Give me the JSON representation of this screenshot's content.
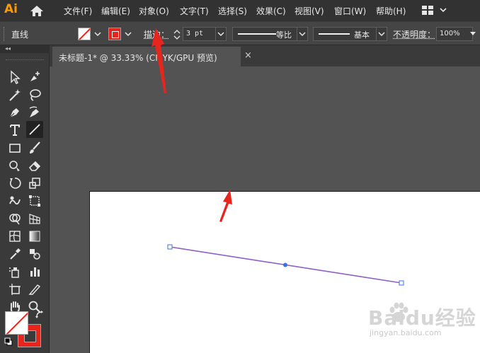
{
  "app": {
    "logo": "Ai",
    "menu": [
      "文件(F)",
      "编辑(E)",
      "对象(O)",
      "文字(T)",
      "选择(S)",
      "效果(C)",
      "视图(V)",
      "窗口(W)",
      "帮助(H)"
    ]
  },
  "icons": [
    "home-icon",
    "workspace-switcher-icon",
    "chevron-down-icon",
    "toolbox-collapse-icon",
    "close-icon",
    "swap-fill-stroke-icon",
    "default-fill-stroke-icon"
  ],
  "control_bar": {
    "tool_name": "直线",
    "stroke_label": "描边：",
    "stroke_weight": "3 pt",
    "variable_width_profile": "等比",
    "brush_definition": "基本",
    "opacity_label": "不透明度：",
    "opacity_value": "100%"
  },
  "colors": {
    "stroke": "#e8251c",
    "fill": "none",
    "path_color": "#8e5fc7",
    "anchor_color": "#3f6fe0",
    "annotation_arrow": "#e8251c"
  },
  "document_tab": {
    "title": "未标题-1* @ 33.33% (CMYK/GPU 预览)",
    "close": "×"
  },
  "toolbox": {
    "collapse": "◂◂",
    "tools": [
      [
        "selection-tool",
        "direct-selection-tool"
      ],
      [
        "magic-wand-tool",
        "lasso-tool"
      ],
      [
        "pen-tool",
        "curvature-tool"
      ],
      [
        "type-tool",
        "line-segment-tool"
      ],
      [
        "rectangle-tool",
        "paintbrush-tool"
      ],
      [
        "shaper-tool",
        "eraser-tool"
      ],
      [
        "rotate-tool",
        "scale-tool"
      ],
      [
        "warp-tool",
        "free-transform-tool"
      ],
      [
        "shape-builder-tool",
        "perspective-grid-tool"
      ],
      [
        "mesh-tool",
        "gradient-tool"
      ],
      [
        "eyedropper-tool",
        "blend-tool"
      ],
      [
        "symbol-sprayer-tool",
        "column-graph-tool"
      ],
      [
        "artboard-tool",
        "slice-tool"
      ],
      [
        "hand-tool",
        "zoom-tool"
      ]
    ],
    "selected_tool": "line-segment-tool"
  },
  "watermark": {
    "brand": "Baidu经验",
    "url": "jingyan.baidu.com"
  }
}
